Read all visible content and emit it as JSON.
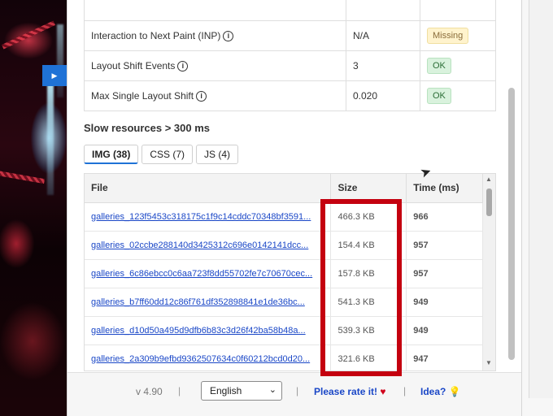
{
  "metrics": [
    {
      "name": "Interaction to Next Paint (INP)",
      "value": "N/A",
      "status": "Missing"
    },
    {
      "name": "Layout Shift Events",
      "value": "3",
      "status": "OK"
    },
    {
      "name": "Max Single Layout Shift",
      "value": "0.020",
      "status": "OK"
    }
  ],
  "slow_resources": {
    "title": "Slow resources > 300 ms",
    "tabs": [
      "IMG (38)",
      "CSS (7)",
      "JS (4)"
    ],
    "columns": [
      "File",
      "Size",
      "Time (ms)"
    ],
    "rows": [
      {
        "file": "galleries_123f5453c318175c1f9c14cddc70348bf3591...",
        "size": "466.3 KB",
        "time": "966"
      },
      {
        "file": "galleries_02ccbe288140d3425312c696e0142141dcc...",
        "size": "154.4 KB",
        "time": "957"
      },
      {
        "file": "galleries_6c86ebcc0c6aa723f8dd55702fe7c70670cec...",
        "size": "157.8 KB",
        "time": "957"
      },
      {
        "file": "galleries_b7ff60dd12c86f761df352898841e1de36bc...",
        "size": "541.3 KB",
        "time": "949"
      },
      {
        "file": "galleries_d10d50a495d9dfb6b83c3d26f42ba58b48a...",
        "size": "539.3 KB",
        "time": "949"
      },
      {
        "file": "galleries_2a309b9efbd9362507634c0f60212bcd0d20...",
        "size": "321.6 KB",
        "time": "947"
      }
    ]
  },
  "footer": {
    "version": "v 4.90",
    "language": "English",
    "rate_label": "Please rate it!",
    "idea_label": "Idea?"
  },
  "colors": {
    "accent": "#1f72d6",
    "time_red": "#b30000",
    "highlight": "#c4000f"
  }
}
